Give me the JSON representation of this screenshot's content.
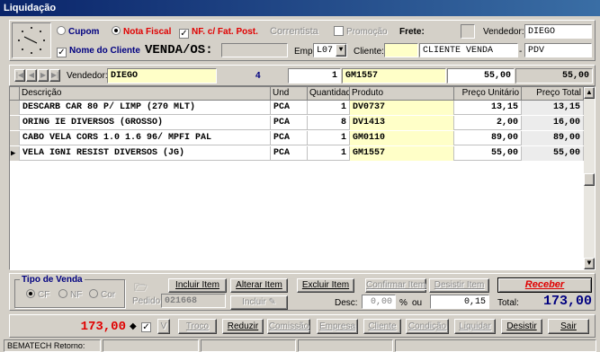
{
  "window": {
    "title": "Liquidação"
  },
  "header": {
    "cupom": "Cupom",
    "nota_fiscal": "Nota Fiscal",
    "nf_fat": "NF. c/ Fat. Post.",
    "correntista": "Correntista",
    "promocao": "Promoção",
    "frete": "Frete:",
    "vendedor_label": "Vendedor:",
    "vendedor_value": "DIEGO",
    "nome_cliente_label": "Nome do Cliente",
    "venda_os": "VENDA/OS:",
    "emp_label": "Emp:",
    "emp_value": "L07",
    "cliente_label": "Cliente:",
    "cliente_value": "CLIENTE VENDA",
    "pdv_value": "PDV"
  },
  "entry": {
    "vendedor_label": "Vendedor:",
    "vendedor_value": "DIEGO",
    "count": "4",
    "quantidade": "1",
    "produto": "GM1557",
    "preco": "55,00",
    "total": "55,00"
  },
  "grid": {
    "headers": [
      "Descrição",
      "Und",
      "Quantidade",
      "Produto",
      "Preço Unitário",
      "Preço Total"
    ],
    "rows": [
      {
        "desc": "DESCARB CAR 80 P/ LIMP (270 MLT)",
        "und": "PCA",
        "qtd": "1",
        "prod": "DV0737",
        "unit": "13,15",
        "total": "13,15"
      },
      {
        "desc": "ORING IE DIVERSOS (GROSSO)",
        "und": "PCA",
        "qtd": "8",
        "prod": "DV1413",
        "unit": "2,00",
        "total": "16,00"
      },
      {
        "desc": "CABO VELA CORS 1.0 1.6 96/ MPFI PAL",
        "und": "PCA",
        "qtd": "1",
        "prod": "GM0110",
        "unit": "89,00",
        "total": "89,00"
      },
      {
        "desc": "VELA IGNI RESIST DIVERSOS (JG)",
        "und": "PCA",
        "qtd": "1",
        "prod": "GM1557",
        "unit": "55,00",
        "total": "55,00"
      }
    ]
  },
  "bottom": {
    "tipo_venda": "Tipo de Venda",
    "cf": "CF",
    "nf": "NF",
    "cor": "Cor",
    "pedido_label": "Pedido",
    "pedido_value": "021668",
    "incluir_item": "Incluir Item",
    "alterar_item": "Alterar Item",
    "excluir_item": "Excluir Item",
    "confirmar_item": "Confirmar Item",
    "desistir_item": "Desistir Item",
    "receber": "Receber",
    "incluir": "Incluir",
    "desc_label": "Desc:",
    "desc_value": "0,00",
    "percent": "%",
    "ou": "ou",
    "desc_abs": "0,15",
    "total_label": "Total:",
    "total_value": "173,00"
  },
  "footer": {
    "amount": "173,00",
    "v": "V",
    "troco": "Troco",
    "reduzir": "Reduzir",
    "comissao": "Comissão",
    "empresa": "Empresa",
    "cliente": "Cliente",
    "condicao": "Condição",
    "liquidar": "Liquidar",
    "desistir": "Desistir",
    "sair": "Sair"
  },
  "status": {
    "printer": "BEMATECH",
    "retorno_label": "Retorno:"
  },
  "colors": {
    "title_start": "#0a246a",
    "title_end": "#3a6ea5",
    "red": "#e00000",
    "navy": "#000080",
    "highlight": "#ffffc8"
  }
}
